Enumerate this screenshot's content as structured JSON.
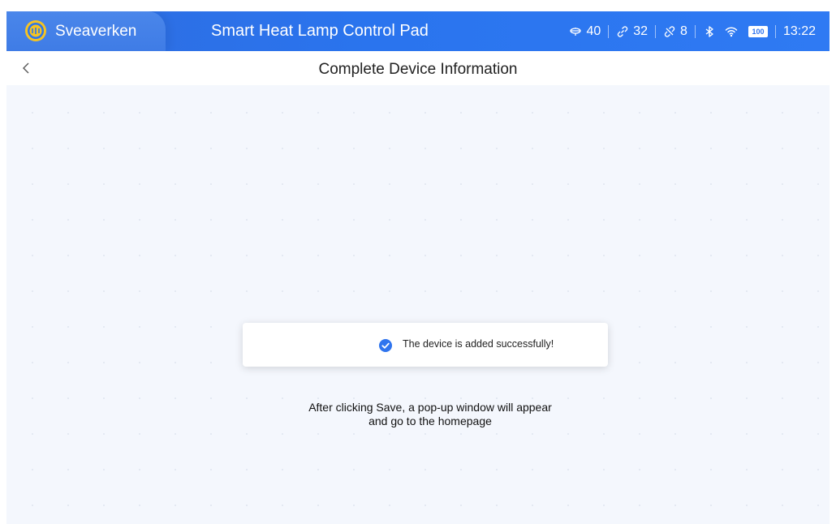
{
  "header": {
    "brand": "Sveaverken",
    "app_title": "Smart Heat Lamp Control Pad",
    "stats": [
      {
        "icon": "lamp-icon",
        "value": "40"
      },
      {
        "icon": "link-icon",
        "value": "32"
      },
      {
        "icon": "unlink-icon",
        "value": "8"
      }
    ],
    "battery": "100",
    "time": "13:22"
  },
  "subheader": {
    "title": "Complete Device Information"
  },
  "toast": {
    "message": "The device is added successfully!"
  },
  "hint": {
    "line1": "After clicking Save, a pop-up window will appear",
    "line2": "and go to the homepage"
  },
  "colors": {
    "topbar": "#2a74ee",
    "background": "#f4f7fd",
    "success": "#2f74ee"
  }
}
